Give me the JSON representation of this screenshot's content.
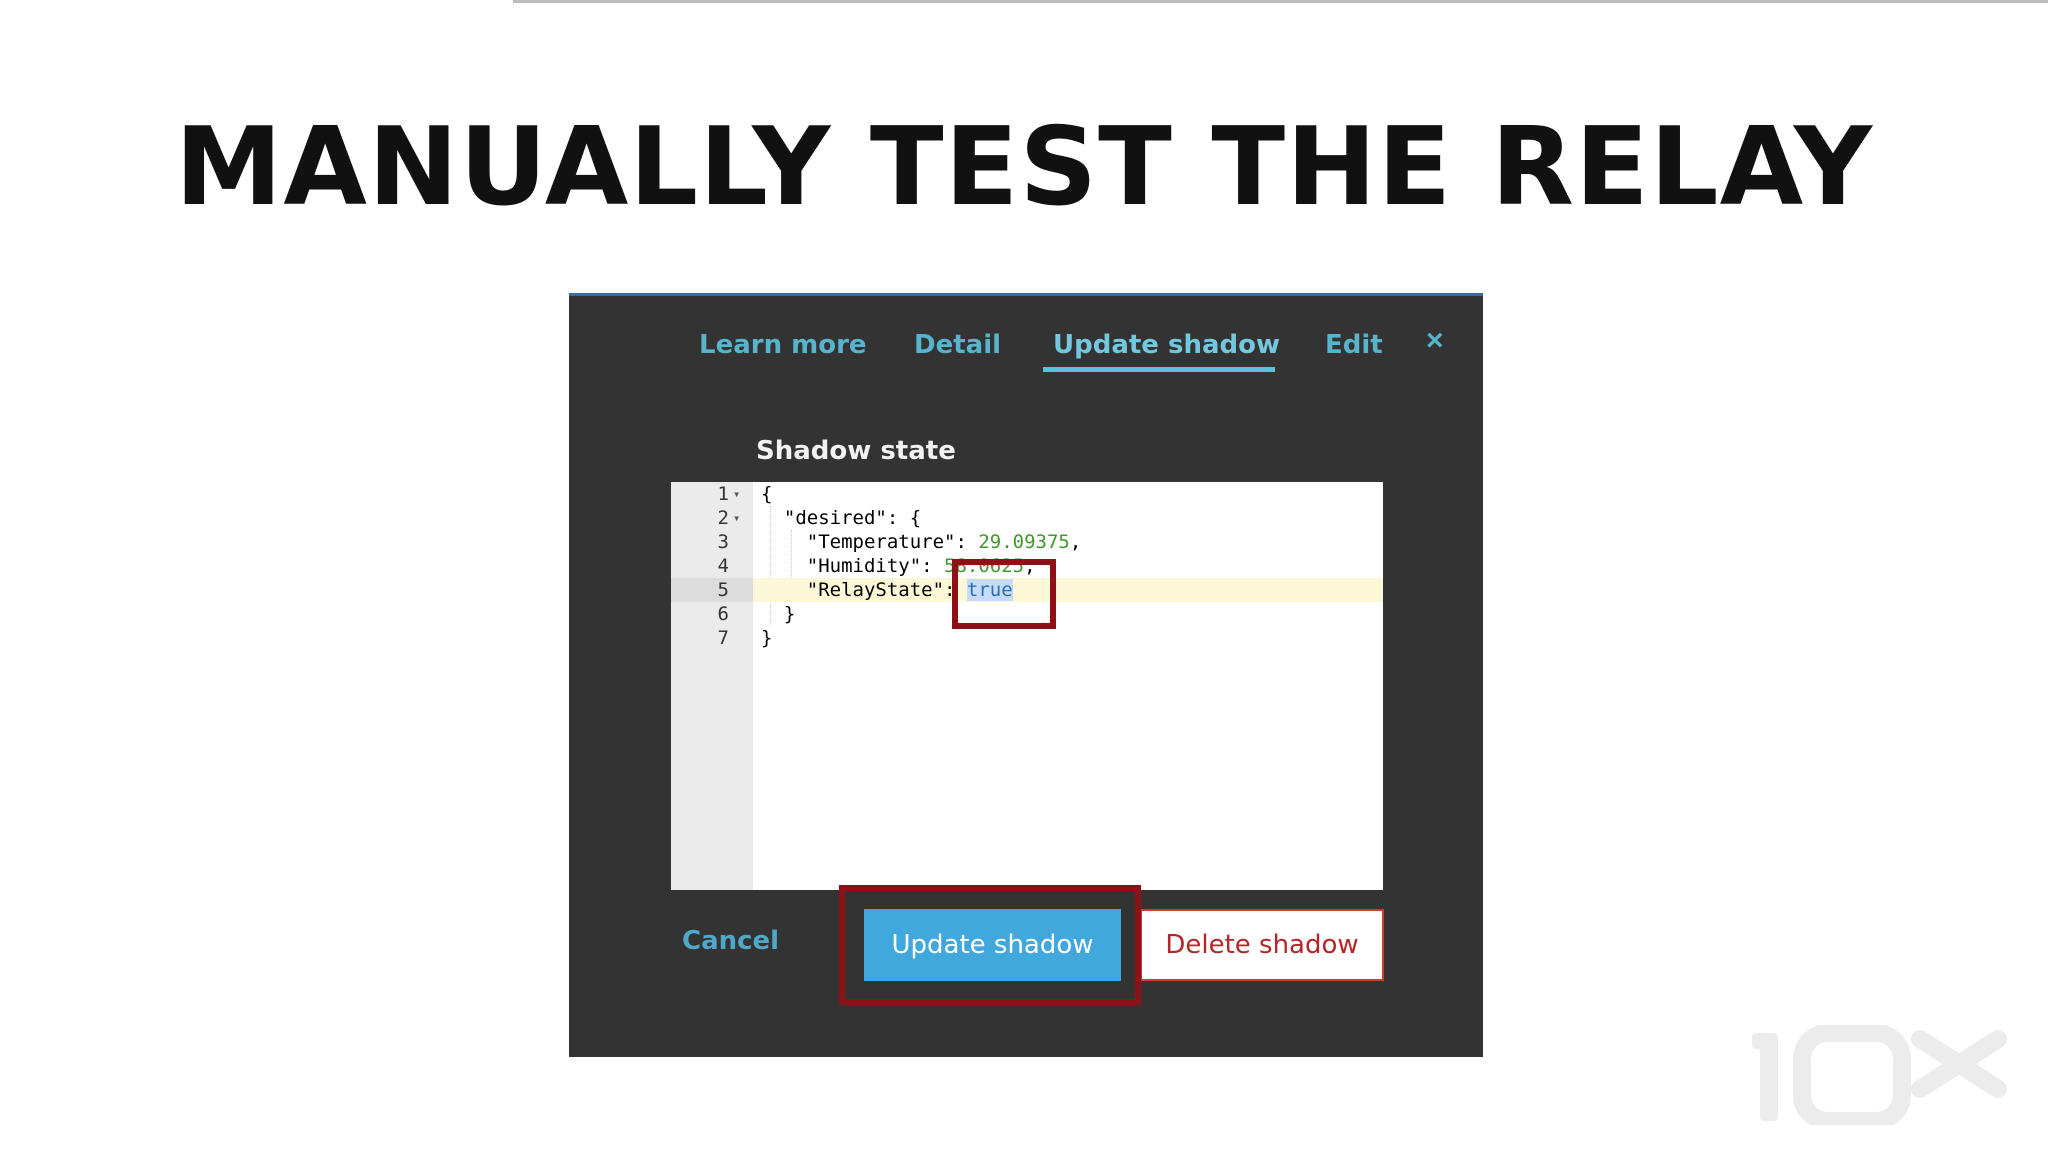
{
  "slide": {
    "title": "MANUALLY TEST THE RELAY"
  },
  "dialog": {
    "tabs": [
      {
        "label": "Learn more",
        "active": false
      },
      {
        "label": "Detail",
        "active": false
      },
      {
        "label": "Update shadow",
        "active": true
      },
      {
        "label": "Edit",
        "active": false
      }
    ],
    "close_icon": "×",
    "section_label": "Shadow state",
    "editor": {
      "lines": [
        {
          "number": "1",
          "fold": true,
          "text": "{"
        },
        {
          "number": "2",
          "fold": true,
          "text": "  \"desired\": {"
        },
        {
          "number": "3",
          "fold": false,
          "key": "    \"Temperature\": ",
          "value": "29.09375",
          "suffix": ","
        },
        {
          "number": "4",
          "fold": false,
          "key": "    \"Humidity\": ",
          "value": "58.0625",
          "suffix": ","
        },
        {
          "number": "5",
          "fold": false,
          "key": "    \"RelayState\": ",
          "value": "true",
          "suffix": "",
          "highlighted": true
        },
        {
          "number": "6",
          "fold": false,
          "text": "  }"
        },
        {
          "number": "7",
          "fold": false,
          "text": "}"
        }
      ]
    },
    "buttons": {
      "cancel": "Cancel",
      "update": "Update shadow",
      "delete": "Delete shadow"
    }
  },
  "colors": {
    "dialog_bg": "#333333",
    "tab_text": "#57b4cc",
    "primary_button": "#41a8dd",
    "danger_text": "#b4262a",
    "callout": "#8d1117"
  },
  "brand": {
    "logo_text": "10x"
  }
}
